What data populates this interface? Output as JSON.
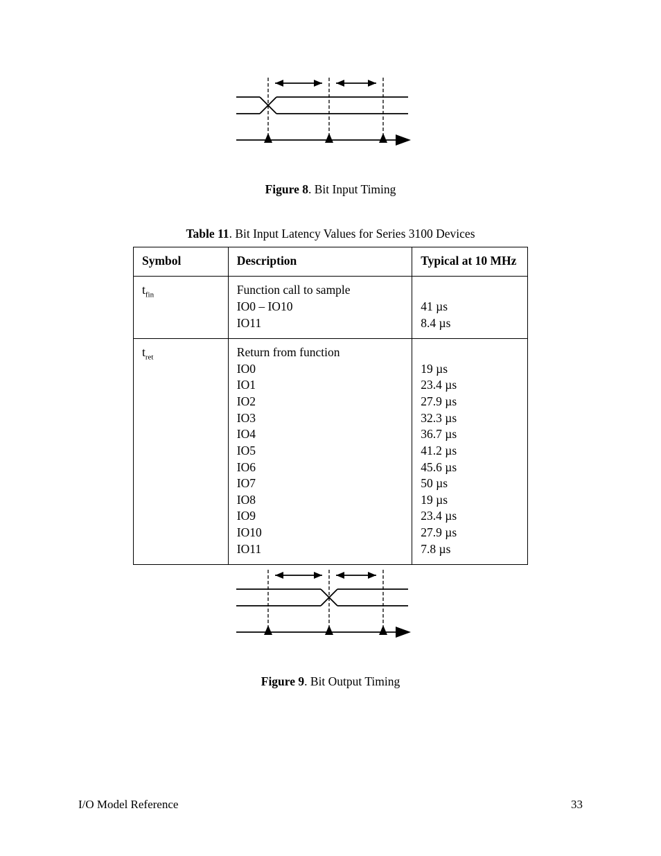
{
  "figure_top": {
    "label_bold": "Figure 8",
    "label_rest": ". Bit Input Timing"
  },
  "table_caption": {
    "bold": "Table 11",
    "rest": ". Bit Input Latency Values for Series 3100 Devices"
  },
  "columns": {
    "symbol": "Symbol",
    "description": "Description",
    "typical": "Typical at 10 MHz"
  },
  "rows": [
    {
      "symbol_main": "t",
      "symbol_sub": "fin",
      "description": [
        "Function call to sample",
        "IO0 – IO10",
        "IO11"
      ],
      "typical": [
        "",
        "41 µs",
        "8.4 µs"
      ]
    },
    {
      "symbol_main": "t",
      "symbol_sub": "ret",
      "description": [
        "Return from function",
        "IO0",
        "IO1",
        "IO2",
        "IO3",
        "IO4",
        "IO5",
        "IO6",
        "IO7",
        "IO8",
        "IO9",
        "IO10",
        "IO11"
      ],
      "typical": [
        "",
        "19 µs",
        "23.4 µs",
        "27.9 µs",
        "32.3 µs",
        "36.7 µs",
        "41.2 µs",
        "45.6 µs",
        "50 µs",
        "19 µs",
        "23.4 µs",
        "27.9 µs",
        "7.8 µs"
      ]
    }
  ],
  "figure_bottom": {
    "label_bold": "Figure 9",
    "label_rest": ". Bit Output Timing"
  },
  "footer": {
    "left": "I/O Model Reference",
    "right": "33"
  }
}
